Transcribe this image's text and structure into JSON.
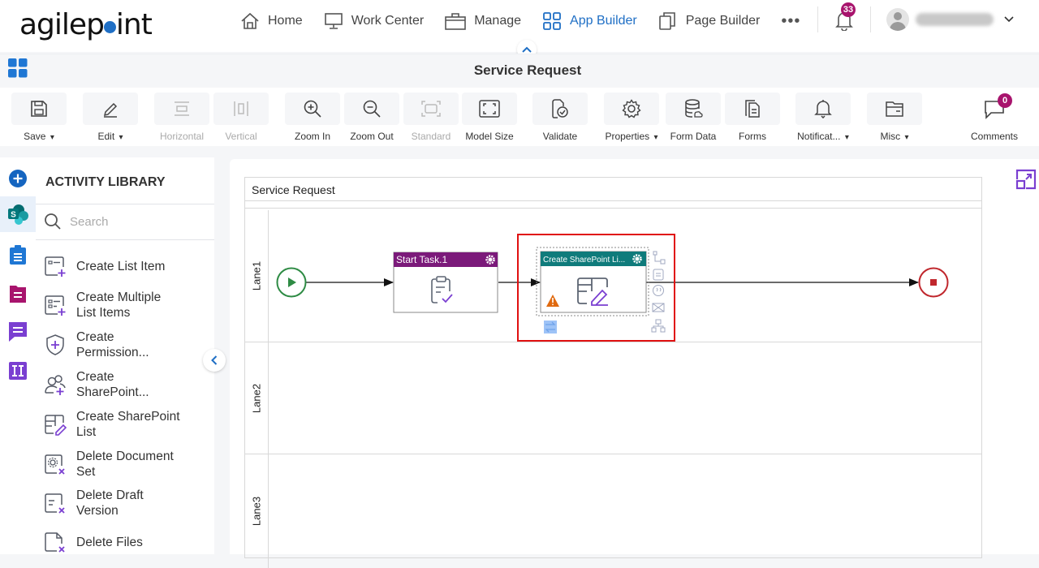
{
  "header": {
    "logo": "agilepoint",
    "nav": [
      {
        "label": "Home",
        "icon": "home-icon"
      },
      {
        "label": "Work Center",
        "icon": "monitor-icon"
      },
      {
        "label": "Manage",
        "icon": "briefcase-icon"
      },
      {
        "label": "App Builder",
        "icon": "grid-icon",
        "active": true
      },
      {
        "label": "Page Builder",
        "icon": "pages-icon"
      }
    ],
    "more": "•••",
    "notifications_count": "33",
    "user_name": "(blurred)"
  },
  "title_bar": {
    "title": "Service Request"
  },
  "toolbar": {
    "buttons": [
      {
        "label": "Save",
        "dropdown": true,
        "enabled": true
      },
      {
        "label": "Edit",
        "dropdown": true,
        "enabled": true
      },
      {
        "label": "Horizontal",
        "dropdown": false,
        "enabled": false
      },
      {
        "label": "Vertical",
        "dropdown": false,
        "enabled": false
      },
      {
        "label": "Zoom In",
        "dropdown": false,
        "enabled": true
      },
      {
        "label": "Zoom Out",
        "dropdown": false,
        "enabled": true
      },
      {
        "label": "Standard",
        "dropdown": false,
        "enabled": false
      },
      {
        "label": "Model Size",
        "dropdown": false,
        "enabled": true
      },
      {
        "label": "Validate",
        "dropdown": false,
        "enabled": true
      },
      {
        "label": "Properties",
        "dropdown": true,
        "enabled": true
      },
      {
        "label": "Form Data",
        "dropdown": false,
        "enabled": true
      },
      {
        "label": "Forms",
        "dropdown": false,
        "enabled": true
      },
      {
        "label": "Notificat...",
        "dropdown": true,
        "enabled": true
      },
      {
        "label": "Misc",
        "dropdown": true,
        "enabled": true
      }
    ],
    "comments_label": "Comments",
    "comments_count": "0",
    "chevron": "⌄"
  },
  "library": {
    "title": "ACTIVITY LIBRARY",
    "search_placeholder": "Search",
    "items": [
      {
        "label": "Create List Item"
      },
      {
        "label": "Create Multiple List Items"
      },
      {
        "label": "Create Permission..."
      },
      {
        "label": "Create SharePoint..."
      },
      {
        "label": "Create SharePoint List"
      },
      {
        "label": "Delete Document Set"
      },
      {
        "label": "Delete Draft Version"
      },
      {
        "label": "Delete Files"
      }
    ]
  },
  "canvas": {
    "pool_title": "Service Request",
    "lanes": [
      "Lane1",
      "Lane2",
      "Lane3"
    ],
    "nodes": {
      "start_task": {
        "title": "Start Task.1",
        "color": "#7b1a7a"
      },
      "create_list": {
        "title": "Create SharePoint Li...",
        "color": "#0f7b7b",
        "warning": true
      }
    },
    "colors": {
      "start_event": "#2e8b44",
      "end_event": "#c0272d",
      "selection": "#e01010"
    }
  }
}
